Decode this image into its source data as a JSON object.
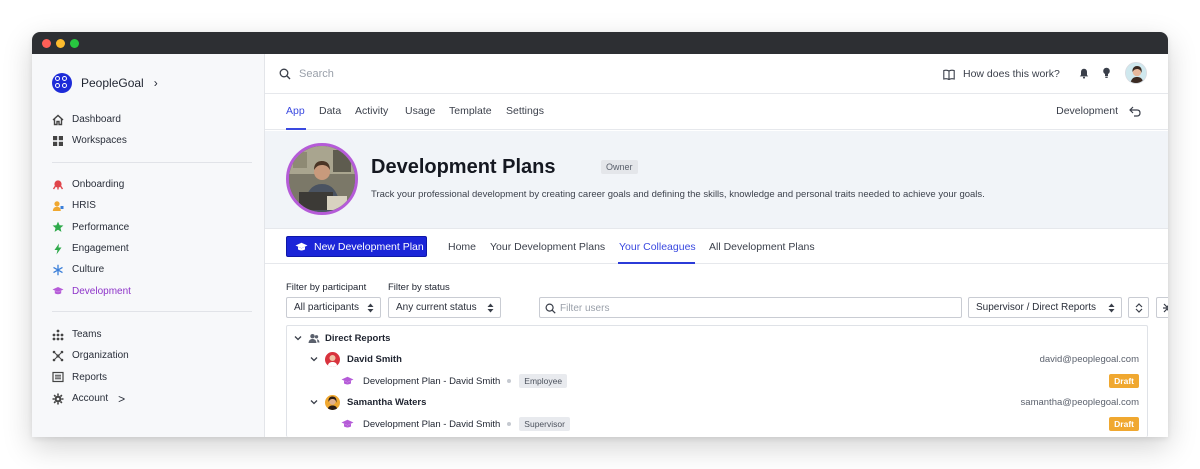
{
  "brand": {
    "name": "PeopleGoal"
  },
  "sidebar": {
    "primary": [
      {
        "label": "Dashboard",
        "icon": "home-icon"
      },
      {
        "label": "Workspaces",
        "icon": "grid-icon"
      }
    ],
    "apps": [
      {
        "label": "Onboarding",
        "icon": "onboarding-icon",
        "color": "#e0454b"
      },
      {
        "label": "HRIS",
        "icon": "user-icon",
        "color": "#f0a830"
      },
      {
        "label": "Performance",
        "icon": "star-icon",
        "color": "#2faa4b"
      },
      {
        "label": "Engagement",
        "icon": "lightning-icon",
        "color": "#2faa4b"
      },
      {
        "label": "Culture",
        "icon": "snowflake-icon",
        "color": "#3b7fd9"
      },
      {
        "label": "Development",
        "icon": "graduation-cap-icon",
        "color": "#b55bd8",
        "active": true
      }
    ],
    "secondary": [
      {
        "label": "Teams",
        "icon": "teams-icon"
      },
      {
        "label": "Organization",
        "icon": "organization-icon"
      },
      {
        "label": "Reports",
        "icon": "reports-icon"
      },
      {
        "label": "Account",
        "icon": "gear-icon",
        "chevron": ">"
      }
    ]
  },
  "topbar": {
    "search_placeholder": "Search",
    "help_label": "How does this work?"
  },
  "tabs": {
    "items": [
      "App",
      "Data",
      "Activity",
      "Usage",
      "Template",
      "Settings"
    ],
    "active": "App",
    "right_label": "Development"
  },
  "hero": {
    "title": "Development Plans",
    "badge": "Owner",
    "description": "Track your professional development by creating career goals and defining the skills, knowledge and personal traits needed to achieve your goals."
  },
  "subnav": {
    "new_button": "New Development Plan",
    "tabs": [
      "Home",
      "Your Development Plans",
      "Your Colleagues",
      "All Development Plans"
    ],
    "active": "Your Colleagues"
  },
  "filters": {
    "participant_label": "Filter by participant",
    "status_label": "Filter by status",
    "participant_value": "All participants",
    "status_value": "Any current status",
    "users_placeholder": "Filter users",
    "relation_value": "Supervisor / Direct Reports"
  },
  "tree": {
    "group_label": "Direct Reports",
    "people": [
      {
        "name": "David Smith",
        "email": "david@peoplegoal.com",
        "plan": "Development Plan - David Smith",
        "role": "Employee",
        "status": "Draft"
      },
      {
        "name": "Samantha Waters",
        "email": "samantha@peoplegoal.com",
        "plan": "Development Plan - David Smith",
        "role": "Supervisor",
        "status": "Draft"
      }
    ]
  },
  "colors": {
    "accent": "#3a49e0",
    "primary_button": "#1b25d8",
    "draft": "#f0a830",
    "development": "#b55bd8"
  }
}
